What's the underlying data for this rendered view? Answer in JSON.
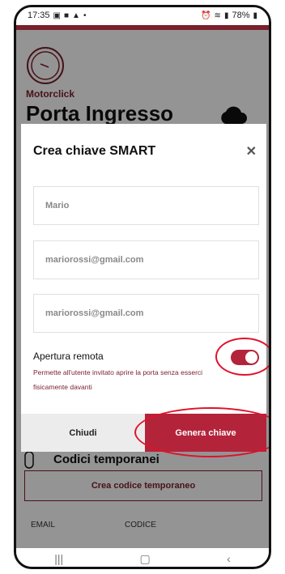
{
  "status_bar": {
    "time": "17:35",
    "battery": "78%",
    "left_icons": [
      "gallery-icon",
      "message-icon",
      "notification-icon",
      "dot-icon"
    ],
    "right_icons": [
      "alarm-icon",
      "wifi-icon",
      "signal-icon",
      "battery-icon"
    ]
  },
  "app": {
    "brand": "Motorclick",
    "device_name": "Porta Ingresso",
    "cloud_icon": "cloud-icon",
    "codes_title": "Codici temporanei",
    "create_code_button": "Crea codice temporaneo",
    "columns": [
      "EMAIL",
      "CODICE"
    ]
  },
  "modal": {
    "title": "Crea chiave SMART",
    "close_glyph": "✕",
    "fields": [
      {
        "value": "Mario"
      },
      {
        "value": "mariorossi@gmail.com"
      },
      {
        "value": "mariorossi@gmail.com"
      }
    ],
    "remote_label": "Apertura remota",
    "remote_description": "Permette all'utente invitato aprire la porta senza esserci fisicamente davanti",
    "remote_enabled": true,
    "close_button": "Chiudi",
    "generate_button": "Genera chiave"
  },
  "navbar": {
    "recent": "|||",
    "home": "▢",
    "back": "‹"
  },
  "colors": {
    "brand": "#7a1f2b",
    "accent": "#b3243a",
    "highlight_ring": "#e0112b"
  }
}
